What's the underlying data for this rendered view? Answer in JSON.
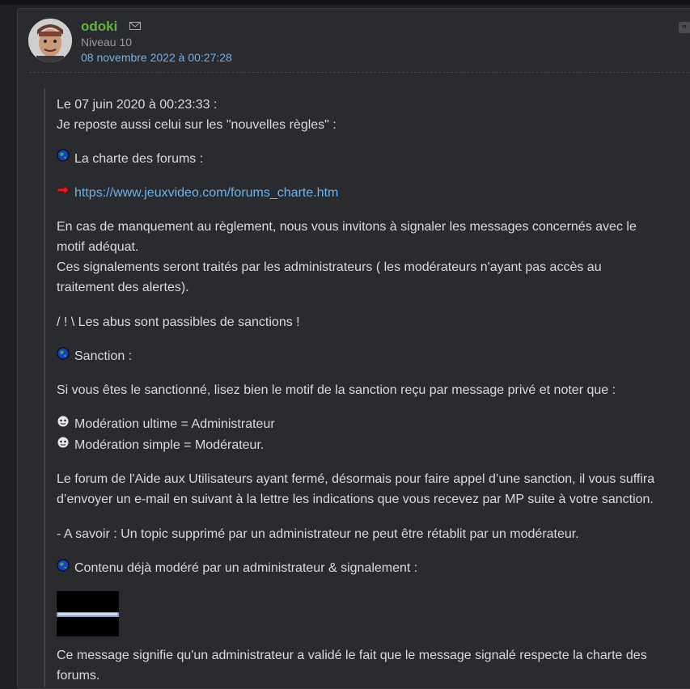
{
  "post": {
    "author": "odoki",
    "level": "Niveau 10",
    "date": "08 novembre 2022 à 00:27:28"
  },
  "quote": {
    "lines": [
      "Le 07 juin 2020 à 00:23:33 :",
      "Je reposte aussi celui sur les \"nouvelles règles\" :",
      "La charte des forums :",
      "https://www.jeuxvideo.com/forums_charte.htm",
      "En cas de manquement au règlement, nous vous invitons à signaler les messages concernés avec le",
      "motif adéquat.",
      "Ces signalements seront traités par les administrateurs ( les modérateurs n'ayant pas accès au",
      "traitement des alertes).",
      "/ ! \\ Les abus sont passibles de sanctions !",
      "Sanction :",
      "Si vous êtes le sanctionné, lisez bien le motif de la sanction reçu par message privé et noter que :",
      "Modération ultime = Administrateur",
      "Modération simple = Modérateur.",
      "Le forum de l'Aide aux Utilisateurs ayant fermé, désormais pour faire appel d’une sanction, il vous suffira",
      "d’envoyer un e-mail en suivant à la lettre les indications que vous recevez par MP suite à votre sanction.",
      "- A savoir : Un topic supprimé par un administrateur ne peut être rétablit par un modérateur.",
      "Contenu déjà modéré par un administrateur & signalement :",
      "Ce message signifie qu'un administrateur a validé le fait que le message signalé respecte la charte des",
      "forums."
    ]
  },
  "icons": {
    "mail": "mail-icon",
    "quote": "quote-icon",
    "globe": "globe-smiley-icon",
    "arrow": "red-arrow-icon",
    "cd": "cd-smiley-icon"
  }
}
